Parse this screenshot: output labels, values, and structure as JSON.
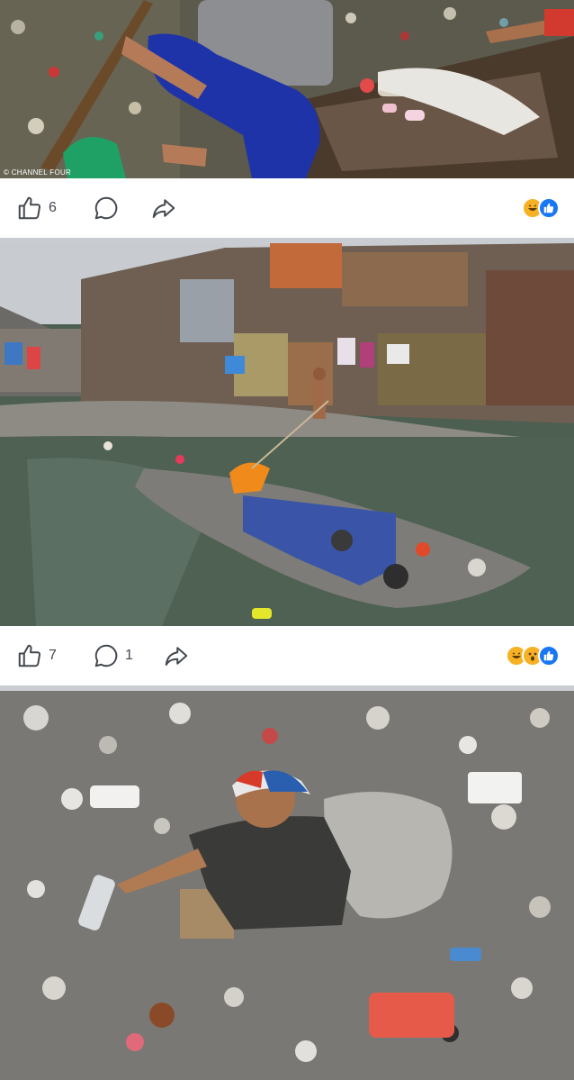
{
  "posts": [
    {
      "credit": "© CHANNEL FOUR",
      "photo_subject": "man in a wooden boat on a river covered with plastic waste",
      "like_count": "6",
      "comment_count": "",
      "reactions": [
        "haha-icon",
        "like-icon"
      ]
    },
    {
      "credit": "",
      "photo_subject": "polluted canal with burning trash island between slum houses",
      "like_count": "7",
      "comment_count": "1",
      "reactions": [
        "haha-icon",
        "wow-icon",
        "like-icon"
      ]
    },
    {
      "credit": "",
      "photo_subject": "man wading waist-deep through river of garbage carrying a sack",
      "like_count": "",
      "comment_count": "",
      "reactions": []
    }
  ],
  "colors": {
    "background": "#c9ccd1",
    "bar": "#ffffff",
    "icon": "#444950",
    "like_blue": "#1877f2",
    "haha_yellow": "#f7b125"
  }
}
